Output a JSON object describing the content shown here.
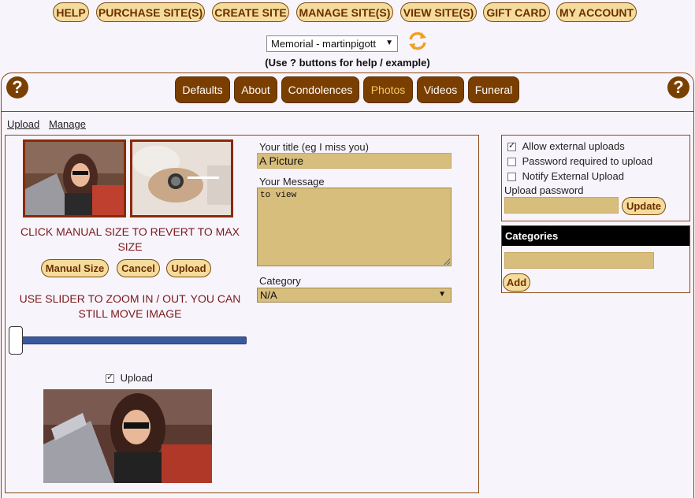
{
  "top_nav": {
    "items": [
      "HELP",
      "PURCHASE SITE(S)",
      "CREATE SITE",
      "MANAGE SITE(S)",
      "VIEW SITE(S)",
      "GIFT CARD",
      "MY ACCOUNT"
    ]
  },
  "site_selector": {
    "selected": "Memorial - martinpigott"
  },
  "help_note": "(Use ? buttons for help / example)",
  "tabs": [
    "Defaults",
    "About",
    "Condolences",
    "Photos",
    "Videos",
    "Funeral"
  ],
  "active_tab": "Photos",
  "sub_links": {
    "upload": "Upload",
    "manage": "Manage"
  },
  "editor": {
    "instruction_size": "CLICK MANUAL SIZE TO REVERT TO MAX SIZE",
    "buttons": {
      "manual_size": "Manual Size",
      "cancel": "Cancel",
      "upload": "Upload"
    },
    "instruction_zoom": "USE SLIDER TO ZOOM IN / OUT. YOU CAN STILL MOVE IMAGE",
    "zoom_level": 0,
    "upload_checkbox_label": "Upload",
    "upload_checked": true
  },
  "form": {
    "title_label": "Your title (eg I miss you)",
    "title_value": "A Picture",
    "message_label": "Your Message",
    "message_value": "to view",
    "category_label": "Category",
    "category_value": "N/A"
  },
  "settings": {
    "allow_external": {
      "label": "Allow external uploads",
      "checked": true
    },
    "password_required": {
      "label": "Password required to upload",
      "checked": false
    },
    "notify_external": {
      "label": "Notify External Upload",
      "checked": false
    },
    "upload_password_label": "Upload password",
    "update_button": "Update"
  },
  "categories": {
    "heading": "Categories",
    "add_button": "Add"
  },
  "colors": {
    "accent_brown": "#7a3f00",
    "pill_fill": "#f5dc9c",
    "field_fill": "#d8be7c",
    "active_tab_text": "#f5c860"
  }
}
